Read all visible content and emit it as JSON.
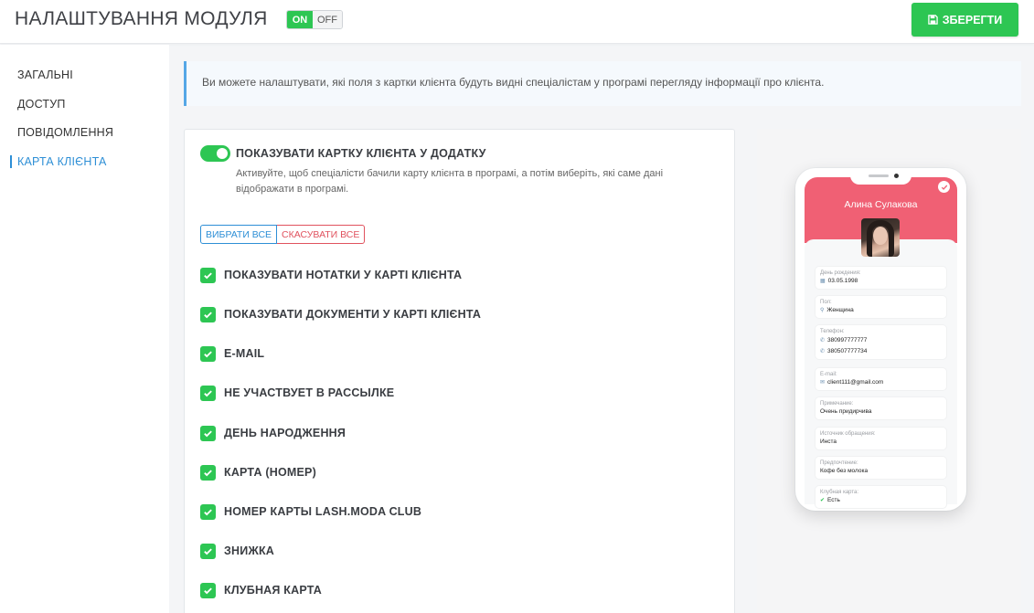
{
  "header": {
    "title": "НАЛАШТУВАННЯ МОДУЛЯ",
    "toggle_on": "ON",
    "toggle_off": "OFF",
    "save_label": "ЗБЕРЕГТИ"
  },
  "sidebar": {
    "items": [
      {
        "label": "ЗАГАЛЬНІ"
      },
      {
        "label": "ДОСТУП"
      },
      {
        "label": "ПОВІДОМЛЕННЯ"
      },
      {
        "label": "КАРТА КЛІЄНТА",
        "active": true
      }
    ]
  },
  "info": {
    "text": "Ви можете налаштувати, які поля з картки клієнта будуть видні спеціалістам у програмі перегляду інформації про клієнта."
  },
  "card": {
    "main_toggle_label": "ПОКАЗУВАТИ КАРТКУ КЛІЄНТА У ДОДАТКУ",
    "main_toggle_on": true,
    "description": "Активуйте, щоб спеціалісти бачили карту клієнта в програмі, а потім виберіть, які саме дані відображати в програмі.",
    "select_all_label": "ВИБРАТИ ВСЕ",
    "cancel_all_label": "СКАСУВАТИ ВСЕ",
    "options": [
      {
        "label": "ПОКАЗУВАТИ НОТАТКИ У КАРТІ КЛІЄНТА",
        "checked": true
      },
      {
        "label": "ПОКАЗУВАТИ ДОКУМЕНТИ У КАРТІ КЛІЄНТА",
        "checked": true
      },
      {
        "label": "E-MAIL",
        "checked": true
      },
      {
        "label": "НЕ УЧАСТВУЕТ В РАССЫЛКЕ",
        "checked": true
      },
      {
        "label": "ДЕНЬ НАРОДЖЕННЯ",
        "checked": true
      },
      {
        "label": "КАРТА (НОМЕР)",
        "checked": true
      },
      {
        "label": "НОМЕР КАРТЫ LASH.MODA CLUB",
        "checked": true
      },
      {
        "label": "ЗНИЖКА",
        "checked": true
      },
      {
        "label": "КЛУБНАЯ КАРТА",
        "checked": true
      }
    ]
  },
  "preview": {
    "client_name": "Алина Сулакова",
    "fields": [
      {
        "label": "День рождения:",
        "values": [
          "03.05.1998"
        ],
        "icon": "calendar-icon"
      },
      {
        "label": "Пол:",
        "values": [
          "Женщина"
        ],
        "icon": "pin-icon"
      },
      {
        "label": "Телефон:",
        "values": [
          "380997777777",
          "380507777734"
        ],
        "icon": "phone-icon"
      },
      {
        "label": "E-mail:",
        "values": [
          "client111@gmail.com"
        ],
        "icon": "mail-icon"
      },
      {
        "label": "Примечание:",
        "values": [
          "Очень придирчива"
        ]
      },
      {
        "label": "Источник обращения:",
        "values": [
          "Инста"
        ]
      },
      {
        "label": "Предпочтение:",
        "values": [
          "Кофе без молока"
        ]
      },
      {
        "label": "Клубная карта:",
        "values": [
          "Есть"
        ],
        "icon": "check-icon"
      }
    ]
  },
  "colors": {
    "accent_green": "#2dc653",
    "accent_blue": "#2e8fd6",
    "accent_red": "#e0525e",
    "phone_header": "#f06074"
  }
}
